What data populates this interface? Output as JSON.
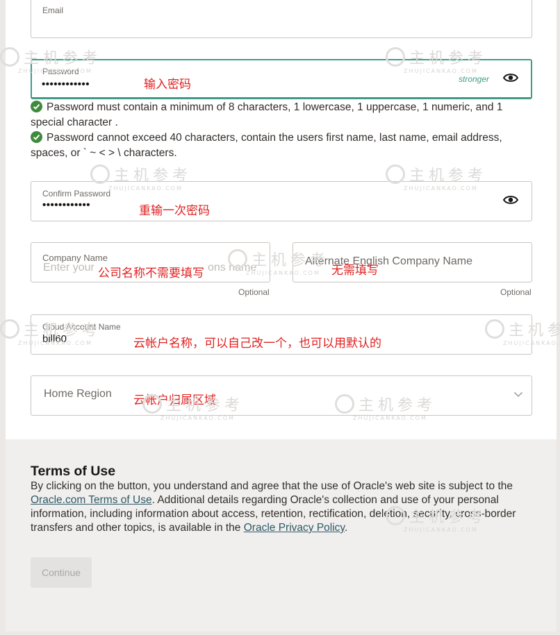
{
  "email": {
    "label": "Email"
  },
  "password": {
    "label": "Password",
    "value": "••••••••••••",
    "strength": "stronger",
    "annotation": "输入密码"
  },
  "requirements": [
    "Password must contain a minimum of 8 characters, 1 lowercase, 1 uppercase, 1 numeric, and 1 special character .",
    "Password cannot exceed 40 characters, contain the users first name, last name, email address, spaces, or ` ~ < > \\ characters."
  ],
  "confirm_password": {
    "label": "Confirm Password",
    "value": "••••••••••••",
    "annotation": "重输一次密码"
  },
  "company_name": {
    "label": "Company Name",
    "placeholder": "Enter your",
    "placeholder_tail": "ons name",
    "optional": "Optional",
    "annotation": "公司名称不需要填写"
  },
  "alternate_company_name": {
    "placeholder": "Alternate English Company Name",
    "optional": "Optional",
    "annotation": "无需填写"
  },
  "cloud_account": {
    "label": "Cloud Account Name",
    "value": "bill60",
    "annotation": "云帐户名称，可以自己改一个，也可以用默认的"
  },
  "home_region": {
    "placeholder": "Home Region",
    "annotation": "云帐户归属区域"
  },
  "terms": {
    "title": "Terms of Use",
    "text_1": "By clicking on the button, you understand and agree that the use of Oracle's web site is subject to the ",
    "link_1": "Oracle.com Terms of Use",
    "text_2": ". Additional details regarding Oracle's collection and use of your personal information, including information about access, retention, rectification, deletion, security, cross-border transfers and other topics, is available in the ",
    "link_2": "Oracle Privacy Policy",
    "text_3": "."
  },
  "continue_label": "Continue",
  "watermark": {
    "cn": "主机参考",
    "en": "ZHUJICANKAO.COM"
  }
}
